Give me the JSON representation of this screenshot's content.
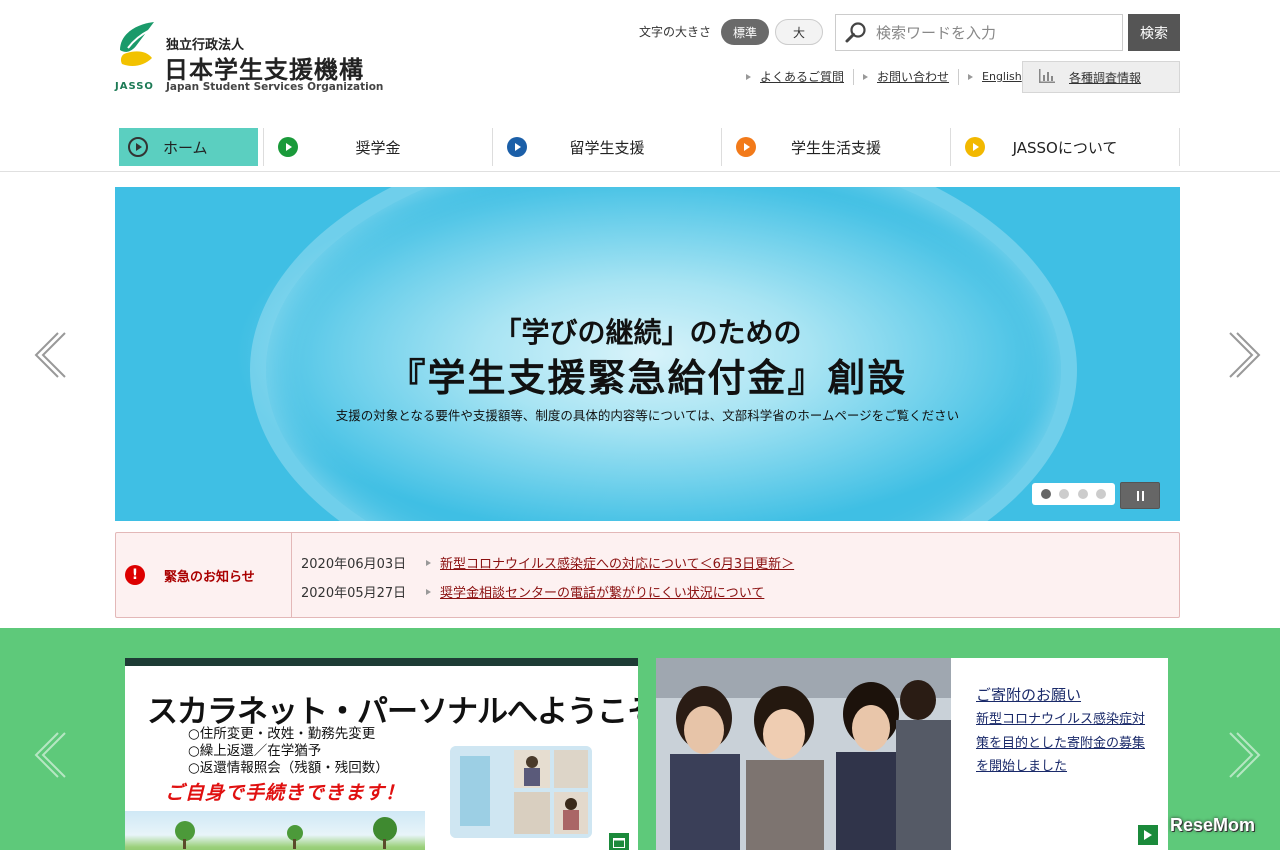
{
  "logo": {
    "org_type": "独立行政法人",
    "name_ja": "日本学生支援機構",
    "name_en": "Japan Student Services Organization",
    "abbr": "JASSO"
  },
  "font_size": {
    "label": "文字の大きさ",
    "standard": "標準",
    "large": "大",
    "selected": "標準"
  },
  "search": {
    "placeholder": "検索ワードを入力",
    "button": "検索"
  },
  "util_links": {
    "faq": "よくあるご質問",
    "contact": "お問い合わせ",
    "english": "English",
    "survey": "各種調査情報"
  },
  "nav": {
    "home": "ホーム",
    "scholarship": "奨学金",
    "study_abroad": "留学生支援",
    "student_life": "学生生活支援",
    "about": "JASSOについて"
  },
  "hero": {
    "line1": "「学びの継続」のための",
    "line2": "『学生支援緊急給付金』創設",
    "line3": "支援の対象となる要件や支援額等、制度の具体的内容等については、文部科学省のホームページをご覧ください",
    "slide_count": 4,
    "active_slide": 1
  },
  "notice": {
    "title": "緊急のお知らせ",
    "items": [
      {
        "date": "2020年06月03日",
        "text": "新型コロナウイルス感染症への対応について＜6月3日更新＞"
      },
      {
        "date": "2020年05月27日",
        "text": "奨学金相談センターの電話が繋がりにくい状況について"
      }
    ]
  },
  "banner1": {
    "title": "スカラネット・パーソナルへようこそ",
    "items": [
      "○住所変更・改姓・勤務先変更",
      "○繰上返還／在学猶予",
      "○返還情報照会（残額・残回数）"
    ],
    "cta": "ご自身で手続きできます！"
  },
  "banner2": {
    "title": "ご寄附のお願い",
    "text": "新型コロナウイルス感染症対策を目的とした寄附金の募集を開始しました"
  },
  "watermark": "ReseMom",
  "colors": {
    "home_tab": "#5bcfc0",
    "scholarship": "#1a9a3a",
    "study_abroad": "#1b5fa8",
    "student_life": "#f27a1a",
    "about": "#f2b800",
    "notice_red": "#a00000",
    "green_band": "#5ec97a"
  }
}
